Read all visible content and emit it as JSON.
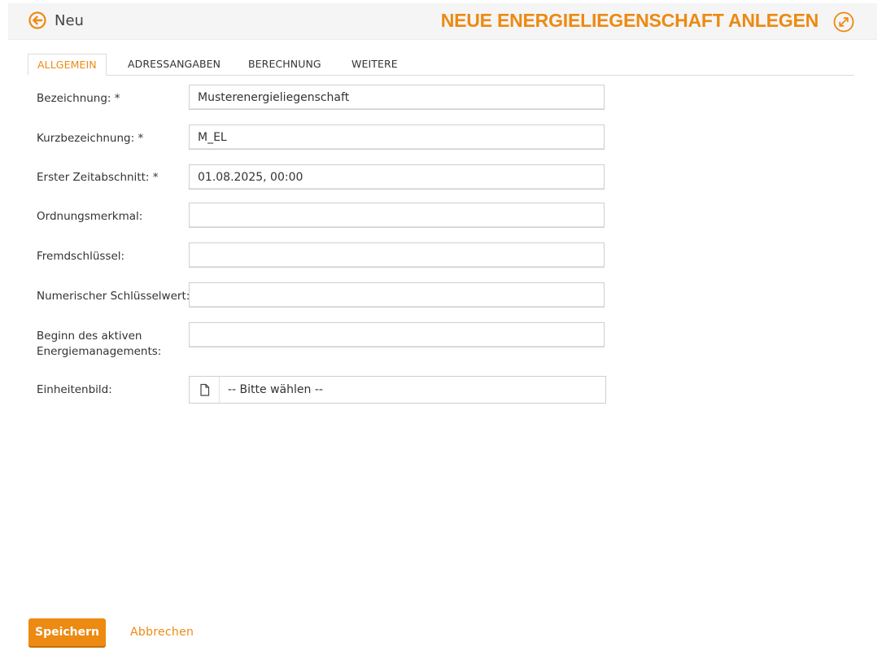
{
  "header": {
    "back_label": "Neu",
    "title": "NEUE ENERGIELIEGENSCHAFT ANLEGEN",
    "accent_color": "#ec8a12"
  },
  "tabs": [
    {
      "label": "ALLGEMEIN",
      "active": true
    },
    {
      "label": "ADRESSANGABEN",
      "active": false
    },
    {
      "label": "BERECHNUNG",
      "active": false
    },
    {
      "label": "WEITERE",
      "active": false
    }
  ],
  "form": {
    "fields": [
      {
        "label": "Bezeichnung: *",
        "value": "Musterenergieliegenschaft"
      },
      {
        "label": "Kurzbezeichnung: *",
        "value": "M_EL"
      },
      {
        "label": "Erster Zeitabschnitt: *",
        "value": "01.08.2025, 00:00"
      },
      {
        "label": "Ordnungsmerkmal:",
        "value": ""
      },
      {
        "label": "Fremdschlüssel:",
        "value": ""
      },
      {
        "label": "Numerischer Schlüsselwert:",
        "value": ""
      },
      {
        "label_line1": "Beginn des aktiven",
        "label_line2": "Energiemanagements:",
        "value": ""
      }
    ],
    "image_field": {
      "label": "Einheitenbild:",
      "placeholder": "-- Bitte wählen --",
      "icon": "file-icon"
    }
  },
  "actions": {
    "save_label": "Speichern",
    "cancel_label": "Abbrechen"
  }
}
